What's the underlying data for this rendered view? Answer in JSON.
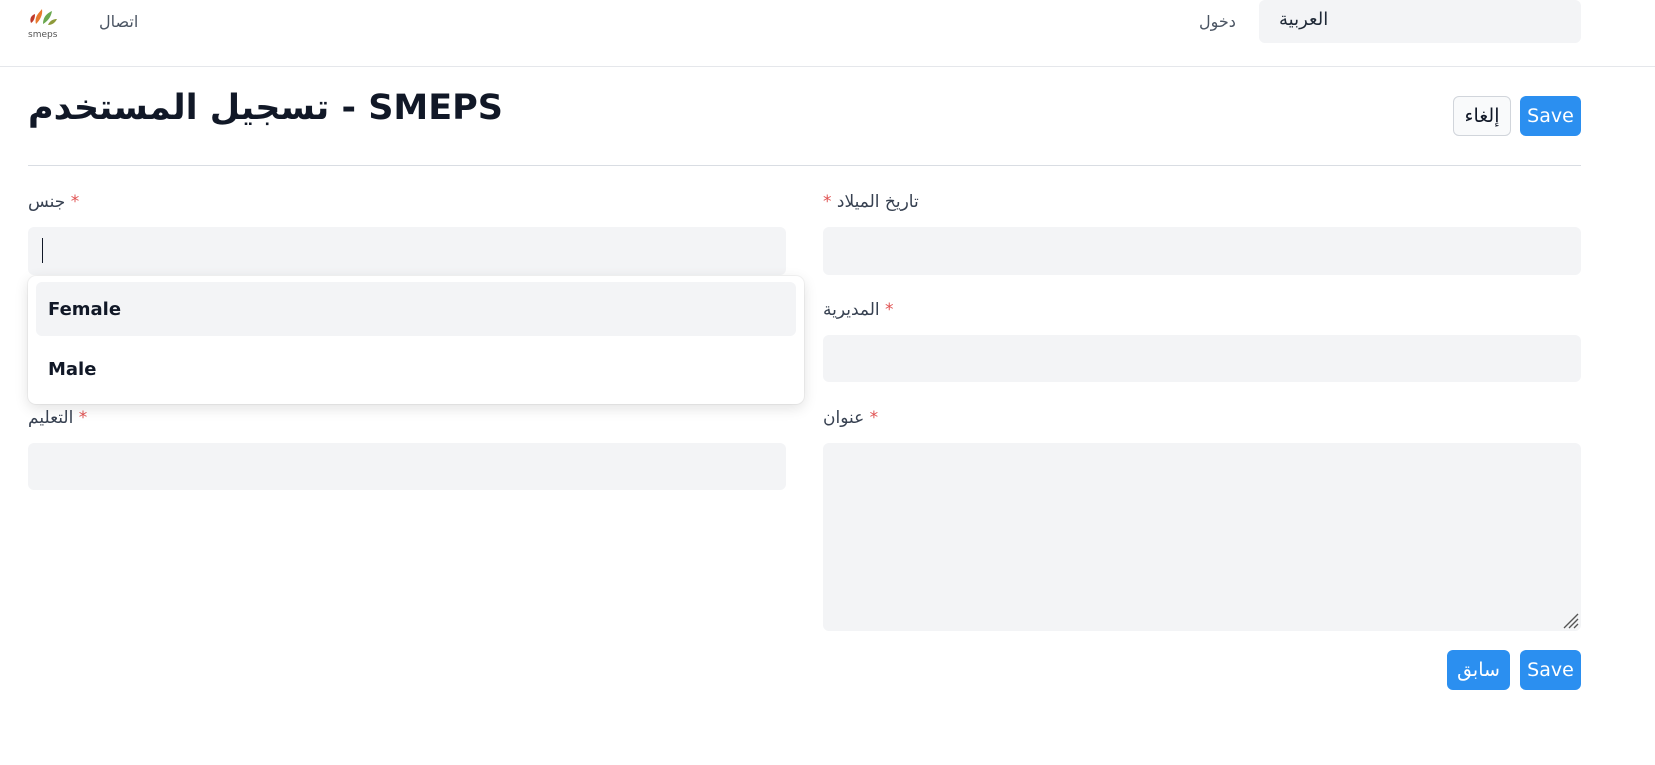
{
  "header": {
    "contact_label": "اتصال",
    "login_label": "دخول",
    "language_value": "العربية",
    "logo_text": "smeps"
  },
  "page": {
    "title": "تسجيل المستخدم - SMEPS",
    "save_label": "Save",
    "cancel_label": "إلغاء",
    "previous_label": "سابق"
  },
  "form": {
    "birth_date_label": "تاريخ الميلاد",
    "gender_label": "جنس",
    "directorate_label": "المديرية",
    "education_label": "التعليم",
    "address_label": "عنوان",
    "required_mark": "*",
    "gender_value": "",
    "birth_date_value": "",
    "directorate_value": "",
    "education_value": "",
    "address_value": ""
  },
  "gender_dropdown": {
    "options": [
      "Female",
      "Male"
    ],
    "highlighted": "Female"
  },
  "colors": {
    "primary": "#2b8ff0",
    "required": "#e05252",
    "field_bg": "#f3f4f6"
  }
}
